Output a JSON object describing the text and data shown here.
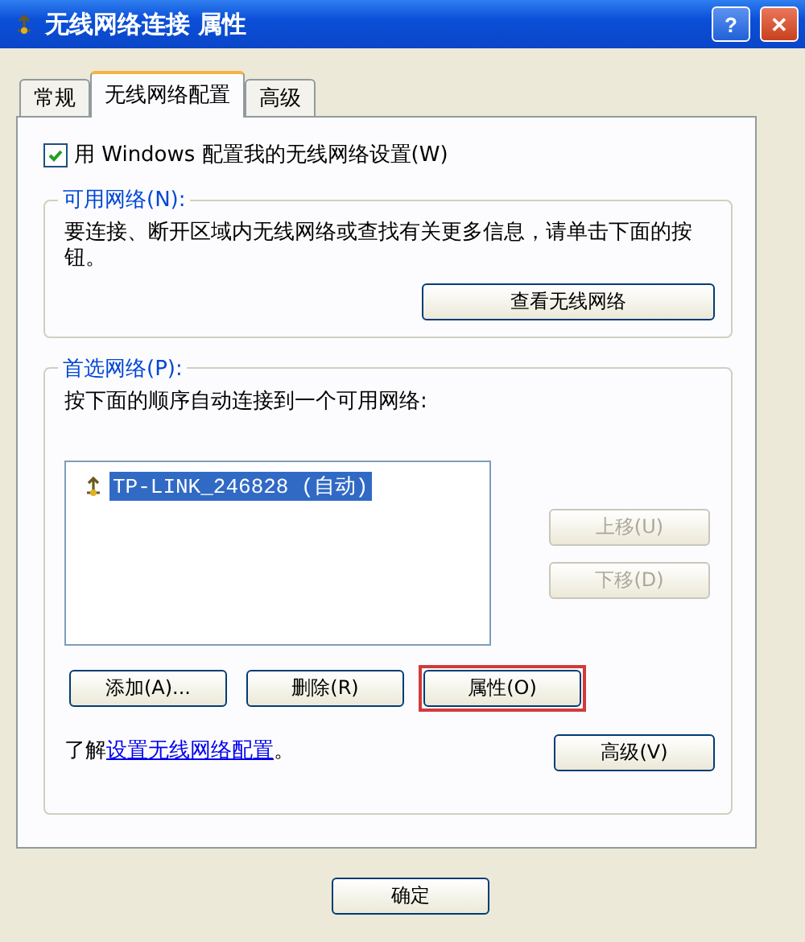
{
  "window": {
    "title": "无线网络连接 属性",
    "controls": [
      "?",
      "✕"
    ]
  },
  "tabs": [
    {
      "label": "常规",
      "selected": false
    },
    {
      "label": "无线网络配置",
      "selected": true
    },
    {
      "label": "高级",
      "selected": false
    }
  ],
  "use_windows": {
    "label": "用 Windows 配置我的无线网络设置(W)",
    "checked": true
  },
  "available": {
    "title": "可用网络(N):",
    "description": "要连接、断开区域内无线网络或查找有关更多信息，请单击下面的按钮。",
    "button": "查看无线网络"
  },
  "preferred": {
    "title": "首选网络(P):",
    "description": "按下面的顺序自动连接到一个可用网络:",
    "networks": [
      {
        "name": "TP-LINK_246828 (自动)",
        "selected": true
      }
    ],
    "side_buttons": [
      {
        "label": "上移(U)",
        "disabled": true
      },
      {
        "label": "下移(D)",
        "disabled": true
      }
    ],
    "buttons": [
      {
        "label": "添加(A)...",
        "highlighted": false
      },
      {
        "label": "删除(R)",
        "highlighted": false
      },
      {
        "label": "属性(O)",
        "highlighted": true
      }
    ],
    "learn_prefix": "了解",
    "learn_link": "设置无线网络配置",
    "learn_suffix": "。",
    "advanced_button": "高级(V)"
  },
  "footer": {
    "buttons": [
      "确定"
    ]
  }
}
